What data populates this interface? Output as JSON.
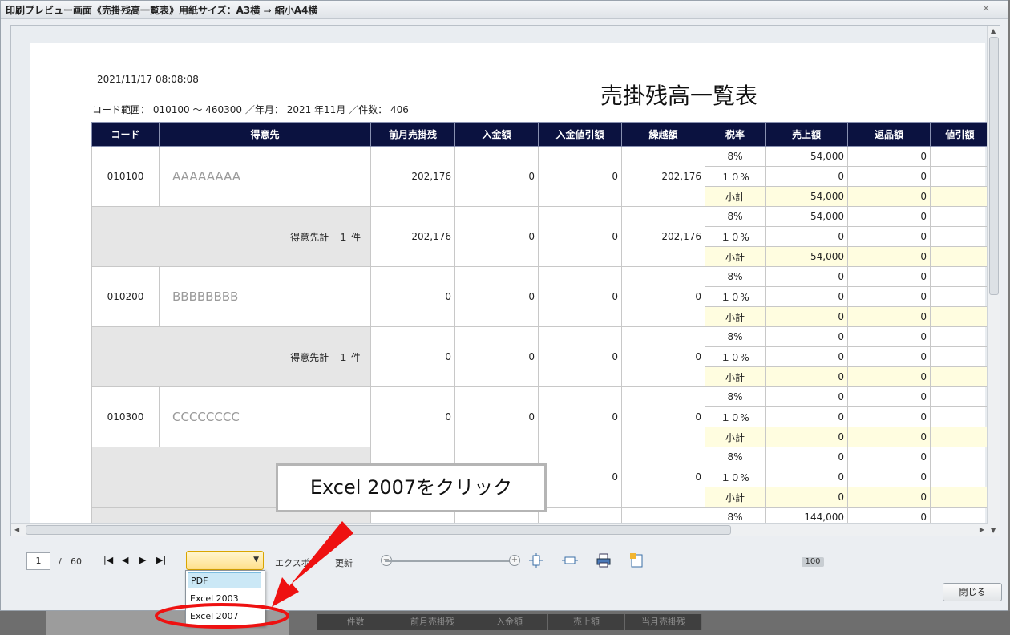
{
  "window": {
    "title": "印刷プレビュー画面《売掛残高一覧表》用紙サイズ：A3横 ⇒ 縮小A4横",
    "close_glyph": "×"
  },
  "report": {
    "timestamp": "2021/11/17 08:08:08",
    "title": "売掛残高一覧表",
    "range": "コード範囲： 010100 ～ 460300 ／年月： 2021 年11月 ／件数： 406",
    "columns": [
      "コード",
      "得意先",
      "前月売掛残",
      "入金額",
      "入金値引額",
      "繰越額",
      "税率",
      "売上額",
      "返品額",
      "値引額"
    ],
    "groups": [
      {
        "code": "010100",
        "name": "AAAAAAAA",
        "prev": "202,176",
        "payment": "0",
        "discount": "0",
        "carry": "202,176",
        "rows": [
          {
            "tax": "8%",
            "sales": "54,000",
            "ret": "0"
          },
          {
            "tax": "１０%",
            "sales": "0",
            "ret": "0"
          },
          {
            "tax": "小計",
            "sales": "54,000",
            "ret": "0"
          }
        ]
      },
      {
        "code": "",
        "name": "得意先計　１ 件",
        "prev": "202,176",
        "payment": "0",
        "discount": "0",
        "carry": "202,176",
        "rows": [
          {
            "tax": "8%",
            "sales": "54,000",
            "ret": "0"
          },
          {
            "tax": "１０%",
            "sales": "0",
            "ret": "0"
          },
          {
            "tax": "小計",
            "sales": "54,000",
            "ret": "0"
          }
        ]
      },
      {
        "code": "010200",
        "name": "BBBBBBBB",
        "prev": "0",
        "payment": "0",
        "discount": "0",
        "carry": "0",
        "rows": [
          {
            "tax": "8%",
            "sales": "0",
            "ret": "0"
          },
          {
            "tax": "１０%",
            "sales": "0",
            "ret": "0"
          },
          {
            "tax": "小計",
            "sales": "0",
            "ret": "0"
          }
        ]
      },
      {
        "code": "",
        "name": "得意先計　１ 件",
        "prev": "0",
        "payment": "0",
        "discount": "0",
        "carry": "0",
        "rows": [
          {
            "tax": "8%",
            "sales": "0",
            "ret": "0"
          },
          {
            "tax": "１０%",
            "sales": "0",
            "ret": "0"
          },
          {
            "tax": "小計",
            "sales": "0",
            "ret": "0"
          }
        ]
      },
      {
        "code": "010300",
        "name": "CCCCCCCC",
        "prev": "0",
        "payment": "0",
        "discount": "0",
        "carry": "0",
        "rows": [
          {
            "tax": "8%",
            "sales": "0",
            "ret": "0"
          },
          {
            "tax": "１０%",
            "sales": "0",
            "ret": "0"
          },
          {
            "tax": "小計",
            "sales": "0",
            "ret": "0"
          }
        ]
      },
      {
        "code": "",
        "name": "",
        "prev": "",
        "payment": "",
        "discount": "0",
        "carry": "0",
        "rows": [
          {
            "tax": "8%",
            "sales": "0",
            "ret": "0"
          },
          {
            "tax": "１０%",
            "sales": "0",
            "ret": "0"
          },
          {
            "tax": "小計",
            "sales": "0",
            "ret": "0"
          }
        ]
      },
      {
        "code": "",
        "name": "",
        "prev": "",
        "payment": "",
        "discount": "",
        "carry": "",
        "rows": [
          {
            "tax": "8%",
            "sales": "144,000",
            "ret": "0"
          }
        ]
      }
    ]
  },
  "toolbar": {
    "page_current": "1",
    "page_separator": "/",
    "page_total": "60",
    "nav": {
      "first": "⏮",
      "prev": "◀",
      "next": "▶",
      "last": "⏭"
    },
    "export_label": "エクスポ",
    "refresh_label": "更新",
    "zoom": "100",
    "zoom_minus": "−",
    "zoom_plus": "+",
    "combo_arrow": "▼"
  },
  "export_options": [
    "PDF",
    "Excel 2003",
    "Excel 2007"
  ],
  "export_selected": "PDF",
  "close_button": "閉じる",
  "background_table_headers": [
    "件数",
    "前月売掛残",
    "入金額",
    "売上額",
    "当月売掛残"
  ],
  "annotation": {
    "callout": "Excel 2007をクリック",
    "accent_color": "#ee1111"
  },
  "colors": {
    "header_bg": "#0b1240",
    "subtotal_bg": "#fffde0",
    "sum_row_bg": "#e6e6e6",
    "combo_bg": "#ffe08a"
  }
}
